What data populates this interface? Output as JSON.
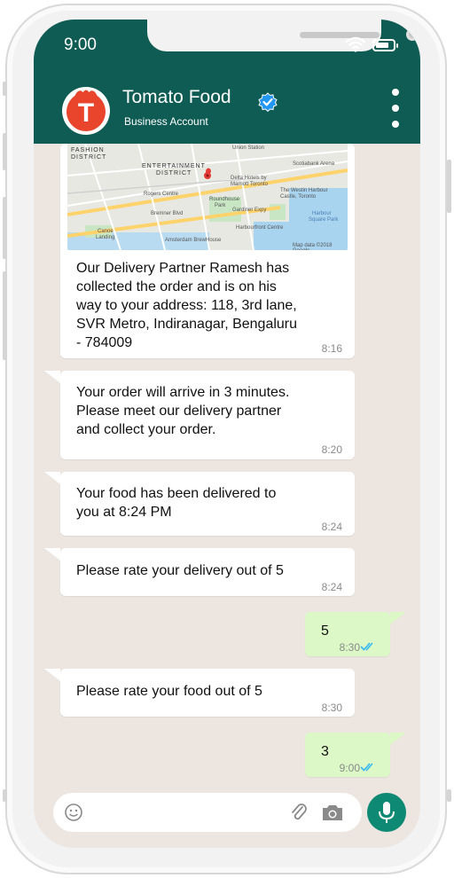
{
  "status_bar": {
    "time": "9:00",
    "battery_level": 0.8
  },
  "header": {
    "title": "Tomato Food",
    "subtitle": "Business Account",
    "logo_letter": "T"
  },
  "map": {
    "labels": [
      "FASHION",
      "DISTRICT",
      "ENTERTAINMENT",
      "DISTRICT",
      "Union Station",
      "Scotiabank Arena",
      "Delta Hotels by",
      "Marriott Toronto",
      "The Westin Harbour",
      "Castle, Toronto",
      "Rogers Centre",
      "Roundhouse",
      "Park",
      "Harbour",
      "Square Park",
      "Bremner Blvd",
      "Gardiner Expy",
      "Canoe",
      "Landing",
      "Harbourfront Centre",
      "Amsterdam BrewHouse",
      "Map data ©2018 Google"
    ]
  },
  "messages": [
    {
      "text": [
        "Our Delivery Partner Ramesh has",
        "collected the order and is on his",
        "way to your address: 118, 3rd lane,",
        "SVR Metro, Indiranagar, Bengaluru",
        "- 784009"
      ],
      "time": "8:16"
    },
    {
      "text": [
        "Your order will arrive in 3 minutes.",
        "Please meet our delivery partner",
        "and collect your order."
      ],
      "time": "8:20"
    },
    {
      "text": [
        "Your food has been delivered to",
        "you at 8:24 PM"
      ],
      "time": "8:24"
    },
    {
      "text": [
        "Please rate your delivery out of 5"
      ],
      "time": "8:24"
    },
    {
      "text": [
        "5"
      ],
      "time": "8:30",
      "outgoing": true
    },
    {
      "text": [
        "Please rate your food out of 5"
      ],
      "time": "8:30"
    },
    {
      "text": [
        "3"
      ],
      "time": "9:00",
      "outgoing": true
    }
  ],
  "colors": {
    "header": "#0e5c54",
    "accent": "#0e8a74",
    "outgoing_bubble": "#dcf8c6",
    "chat_bg": "#ece5e0",
    "tick": "#34b7f1"
  }
}
